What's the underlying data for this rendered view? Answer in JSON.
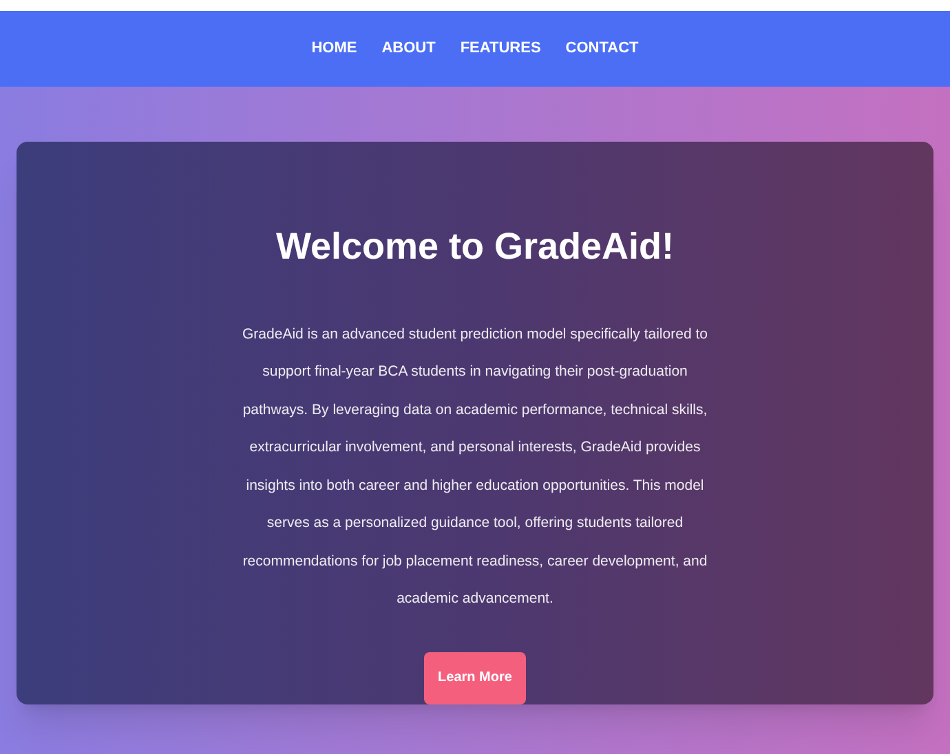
{
  "nav": {
    "items": [
      {
        "label": "HOME"
      },
      {
        "label": "ABOUT"
      },
      {
        "label": "FEATURES"
      },
      {
        "label": "CONTACT"
      }
    ]
  },
  "hero": {
    "title": "Welcome to GradeAid!",
    "description": "GradeAid is an advanced student prediction model specifically tailored to support final-year BCA students in navigating their post-graduation pathways. By leveraging data on academic performance, technical skills, extracurricular involvement, and personal interests, GradeAid provides insights into both career and higher education opportunities. This model serves as a personalized guidance tool, offering students tailored recommendations for job placement readiness, career development, and academic advancement.",
    "button": "Learn More"
  }
}
